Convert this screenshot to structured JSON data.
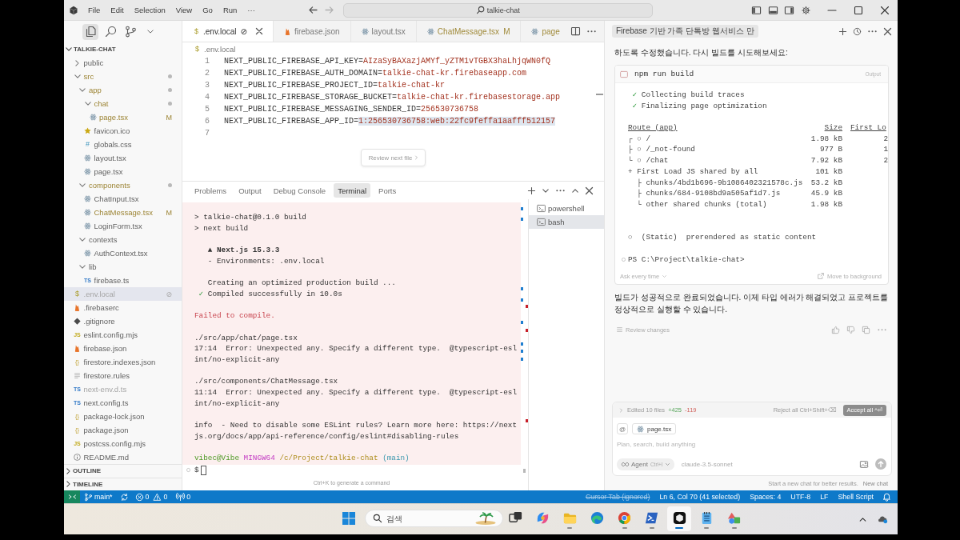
{
  "window": {
    "menu": [
      "File",
      "Edit",
      "Selection",
      "View",
      "Go",
      "Run",
      "···"
    ],
    "command_center": "talkie-chat"
  },
  "activity": [
    {
      "kind": "files",
      "selected": true
    },
    {
      "kind": "search",
      "selected": false
    },
    {
      "kind": "source-control",
      "selected": false
    },
    {
      "kind": "more",
      "selected": false
    }
  ],
  "explorer": {
    "title": "TALKIE-CHAT",
    "expanded": true,
    "tree": [
      {
        "name": "public",
        "kind": "folder",
        "expanded": false,
        "selected": false,
        "modified": false,
        "ignored": false
      },
      {
        "name": "src",
        "kind": "folder",
        "expanded": true,
        "selected": false,
        "modified": true,
        "ignored": false,
        "children": [
          {
            "name": "app",
            "kind": "folder",
            "expanded": true,
            "selected": false,
            "modified": true,
            "ignored": false,
            "children": [
              {
                "name": "chat",
                "kind": "folder",
                "expanded": true,
                "selected": false,
                "modified": true,
                "ignored": false,
                "children": [
                  {
                    "name": "page.tsx",
                    "kind": "react",
                    "badge": "M",
                    "selected": false,
                    "modified": true,
                    "ignored": false
                  }
                ]
              },
              {
                "name": "favicon.ico",
                "kind": "star",
                "selected": false,
                "modified": false,
                "ignored": false
              },
              {
                "name": "globals.css",
                "kind": "css",
                "glyph": "#",
                "selected": false,
                "modified": false,
                "ignored": false
              },
              {
                "name": "layout.tsx",
                "kind": "react",
                "selected": false,
                "modified": false,
                "ignored": false
              },
              {
                "name": "page.tsx",
                "kind": "react",
                "selected": false,
                "modified": false,
                "ignored": false
              }
            ]
          },
          {
            "name": "components",
            "kind": "folder",
            "expanded": true,
            "selected": false,
            "modified": true,
            "ignored": false,
            "children": [
              {
                "name": "ChatInput.tsx",
                "kind": "react",
                "selected": false,
                "modified": false,
                "ignored": false
              },
              {
                "name": "ChatMessage.tsx",
                "kind": "react",
                "badge": "M",
                "selected": false,
                "modified": true,
                "ignored": false
              },
              {
                "name": "LoginForm.tsx",
                "kind": "react",
                "selected": false,
                "modified": false,
                "ignored": false
              }
            ]
          },
          {
            "name": "contexts",
            "kind": "folder",
            "expanded": true,
            "selected": false,
            "modified": false,
            "ignored": false,
            "children": [
              {
                "name": "AuthContext.tsx",
                "kind": "react",
                "selected": false,
                "modified": false,
                "ignored": false
              }
            ]
          },
          {
            "name": "lib",
            "kind": "folder",
            "expanded": true,
            "selected": false,
            "modified": false,
            "ignored": false,
            "children": [
              {
                "name": "firebase.ts",
                "kind": "ts",
                "glyph": "TS",
                "selected": false,
                "modified": false,
                "ignored": false
              }
            ]
          }
        ]
      },
      {
        "name": ".env.local",
        "kind": "env",
        "glyph": "$",
        "badge": "⊘",
        "selected": true,
        "modified": false,
        "ignored": true
      },
      {
        "name": ".firebaserc",
        "kind": "firebase",
        "selected": false,
        "modified": false,
        "ignored": false
      },
      {
        "name": ".gitignore",
        "kind": "git",
        "selected": false,
        "modified": false,
        "ignored": false
      },
      {
        "name": "eslint.config.mjs",
        "kind": "js",
        "glyph": "JS",
        "selected": false,
        "modified": false,
        "ignored": false
      },
      {
        "name": "firebase.json",
        "kind": "firebase",
        "selected": false,
        "modified": false,
        "ignored": false
      },
      {
        "name": "firestore.indexes.json",
        "kind": "json",
        "glyph": "{}",
        "selected": false,
        "modified": false,
        "ignored": false
      },
      {
        "name": "firestore.rules",
        "kind": "lines",
        "selected": false,
        "modified": false,
        "ignored": false
      },
      {
        "name": "next-env.d.ts",
        "kind": "ts",
        "glyph": "TS",
        "selected": false,
        "modified": false,
        "ignored": true
      },
      {
        "name": "next.config.ts",
        "kind": "ts",
        "glyph": "TS",
        "selected": false,
        "modified": false,
        "ignored": false
      },
      {
        "name": "package-lock.json",
        "kind": "json",
        "glyph": "{}",
        "selected": false,
        "modified": false,
        "ignored": false
      },
      {
        "name": "package.json",
        "kind": "json",
        "glyph": "{}",
        "selected": false,
        "modified": false,
        "ignored": false
      },
      {
        "name": "postcss.config.mjs",
        "kind": "js",
        "glyph": "JS",
        "selected": false,
        "modified": false,
        "ignored": false
      },
      {
        "name": "README.md",
        "kind": "info",
        "selected": false,
        "modified": false,
        "ignored": false
      }
    ]
  },
  "sections": [
    {
      "title": "OUTLINE",
      "expanded": false
    },
    {
      "title": "TIMELINE",
      "expanded": false
    }
  ],
  "editor": {
    "tabs": [
      {
        "label": ".env.local",
        "kind": "env",
        "glyph": "$",
        "badge": "⊘",
        "selected": true,
        "modified": false
      },
      {
        "label": "firebase.json",
        "kind": "firebase",
        "selected": false,
        "modified": false
      },
      {
        "label": "layout.tsx",
        "kind": "react",
        "selected": false,
        "modified": false
      },
      {
        "label": "ChatMessage.tsx",
        "kind": "react",
        "badge": "M",
        "selected": false,
        "modified": true
      },
      {
        "label": "page",
        "kind": "react",
        "selected": false,
        "modified": true
      }
    ],
    "breadcrumb": {
      "kind": "env",
      "glyph": "$",
      "label": ".env.local"
    },
    "lines": [
      {
        "number": "1",
        "key": "NEXT_PUBLIC_FIREBASE_API_KEY=",
        "value": "AIzaSyBAXazjAMYf_yZTM1vTGBX3haLhjqWN0fQ",
        "highlighted": false
      },
      {
        "number": "2",
        "key": "NEXT_PUBLIC_FIREBASE_AUTH_DOMAIN=",
        "value": "talkie-chat-kr.firebaseapp.com",
        "highlighted": false
      },
      {
        "number": "3",
        "key": "NEXT_PUBLIC_FIREBASE_PROJECT_ID=",
        "value": "talkie-chat-kr",
        "highlighted": false
      },
      {
        "number": "4",
        "key": "NEXT_PUBLIC_FIREBASE_STORAGE_BUCKET=",
        "value": "talkie-chat-kr.firebasestorage.app",
        "highlighted": false
      },
      {
        "number": "5",
        "key": "NEXT_PUBLIC_FIREBASE_MESSAGING_SENDER_ID=",
        "value": "256530736758",
        "highlighted": false
      },
      {
        "number": "6",
        "key": "NEXT_PUBLIC_FIREBASE_APP_ID=",
        "value": "1:256530736758:web:22fc9feffa1aafff512157",
        "highlighted": true
      },
      {
        "number": "7"
      }
    ],
    "review_button": "Review next file"
  },
  "panel": {
    "tabs": [
      {
        "label": "Problems",
        "selected": false
      },
      {
        "label": "Output",
        "selected": false
      },
      {
        "label": "Debug Console",
        "selected": false
      },
      {
        "label": "Terminal",
        "selected": true
      },
      {
        "label": "Ports",
        "selected": false
      }
    ],
    "terminal": {
      "lines": [
        {
          "kind": "text",
          "segments": [
            {
              "text": "> talkie-chat@0.1.0 build",
              "kind": "plain"
            }
          ]
        },
        {
          "kind": "text",
          "segments": [
            {
              "text": "> next build",
              "kind": "plain"
            }
          ]
        },
        {
          "kind": "blank"
        },
        {
          "kind": "text",
          "segments": [
            {
              "text": "   ▲ Next.js 15.3.3",
              "kind": "bold"
            }
          ]
        },
        {
          "kind": "text",
          "segments": [
            {
              "text": "   - Environments: .env.local",
              "kind": "plain"
            }
          ]
        },
        {
          "kind": "blank"
        },
        {
          "kind": "text",
          "segments": [
            {
              "text": "   Creating an optimized production build ...",
              "kind": "plain"
            }
          ]
        },
        {
          "kind": "text",
          "segments": [
            {
              "text": " ✓",
              "kind": "ok"
            },
            {
              "text": " Compiled successfully in 10.0s",
              "kind": "plain"
            }
          ]
        },
        {
          "kind": "blank"
        },
        {
          "kind": "text",
          "segments": [
            {
              "text": "Failed to compile.",
              "kind": "error"
            }
          ]
        },
        {
          "kind": "blank"
        },
        {
          "kind": "text",
          "segments": [
            {
              "text": "./src/app/chat/page.tsx",
              "kind": "plain"
            }
          ]
        },
        {
          "kind": "text",
          "segments": [
            {
              "text": "17:14  Error: Unexpected any. Specify a different type.  @typescript-esl",
              "kind": "plain"
            }
          ]
        },
        {
          "kind": "text",
          "segments": [
            {
              "text": "int/no-explicit-any",
              "kind": "plain"
            }
          ]
        },
        {
          "kind": "blank"
        },
        {
          "kind": "text",
          "segments": [
            {
              "text": "./src/components/ChatMessage.tsx",
              "kind": "plain"
            }
          ]
        },
        {
          "kind": "text",
          "segments": [
            {
              "text": "11:14  Error: Unexpected any. Specify a different type.  @typescript-esl",
              "kind": "plain"
            }
          ]
        },
        {
          "kind": "text",
          "segments": [
            {
              "text": "int/no-explicit-any",
              "kind": "plain"
            }
          ]
        },
        {
          "kind": "blank"
        },
        {
          "kind": "text",
          "segments": [
            {
              "text": "info  - Need to disable some ESLint rules? Learn more here: https://next",
              "kind": "plain"
            }
          ]
        },
        {
          "kind": "text",
          "segments": [
            {
              "text": "js.org/docs/app/api-reference/config/eslint#disabling-rules",
              "kind": "plain"
            }
          ]
        },
        {
          "kind": "blank"
        },
        {
          "kind": "text",
          "segments": [
            {
              "text": "vibec@Vibe",
              "kind": "user"
            },
            {
              "text": " MINGW64",
              "kind": "host"
            },
            {
              "text": " /c/Project/talkie-chat",
              "kind": "path"
            },
            {
              "text": " (main)",
              "kind": "branch"
            }
          ]
        }
      ],
      "prompt": "$",
      "hint": "Ctrl+K to generate a command"
    },
    "terminals": [
      {
        "name": "powershell",
        "selected": false
      },
      {
        "name": "bash",
        "selected": true
      }
    ]
  },
  "chat": {
    "title": "Firebase 기반 가족 단톡방 웹서비스 만",
    "intro": "하도록 수정했습니다. 다시 빌드를 시도해보세요:",
    "command_card": {
      "command": "npm run build",
      "output_label": "Output",
      "lines": [
        {
          "kind": "text",
          "segments": [
            {
              "text": " ✓",
              "kind": "ok"
            },
            {
              "text": " Collecting build traces",
              "kind": "plain"
            }
          ]
        },
        {
          "kind": "text",
          "segments": [
            {
              "text": " ✓",
              "kind": "ok"
            },
            {
              "text": " Finalizing page optimization",
              "kind": "plain"
            }
          ]
        }
      ],
      "routes": {
        "columns": [
          "Route (app)",
          "Size",
          "First Lo"
        ],
        "rows": [
          {
            "name": "┌ ○ /",
            "size": "1.98 kB",
            "first_load": "2"
          },
          {
            "name": "├ ○ /_not-found",
            "size": "977 B",
            "first_load": "1"
          },
          {
            "name": "└ ○ /chat",
            "size": "7.92 kB",
            "first_load": "2"
          },
          {
            "name": "+ First Load JS shared by all",
            "size": "101 kB"
          },
          {
            "name": "  ├ chunks/4bd1b696-9b1086402321578c.js",
            "size": "53.2 kB"
          },
          {
            "name": "  ├ chunks/684-9108bd9a505af1d7.js",
            "size": "45.9 kB"
          },
          {
            "name": "  └ other shared chunks (total)",
            "size": "1.98 kB"
          }
        ]
      },
      "legend": "○  (Static)  prerendered as static content",
      "prompt": "PS C:\\Project\\talkie-chat>",
      "approval": "Ask every time",
      "background_button": "Move to background"
    },
    "reply": "빌드가 성공적으로 완료되었습니다. 이제 타입 에러가 해결되었고 프로젝트를 정상적으로 실행할 수 있습니다.",
    "review": "Review changes",
    "composer": {
      "edited": "Edited 10 files",
      "added": "+425",
      "removed": "-119",
      "reject": "Reject all Ctrl+Shift+⌫",
      "accept": "Accept all ^⏎",
      "mention": "@",
      "context_file": {
        "kind": "react",
        "label": "page.tsx"
      },
      "placeholder": "Plan, search, build anything",
      "mode": "Agent",
      "mode_shortcut": "Ctrl+I",
      "model": "claude-3.5-sonnet",
      "footer": "Start a new chat for better results.",
      "new_chat": "New chat"
    }
  },
  "status_bar": {
    "branch": "main*",
    "errors": "0",
    "warnings": "0",
    "ports": "0",
    "items": [
      {
        "text": "Cursor Tab (ignored)",
        "disabled": true
      },
      {
        "text": "Ln 6, Col 70 (41 selected)",
        "disabled": false
      },
      {
        "text": "Spaces: 4",
        "disabled": false
      },
      {
        "text": "UTF-8",
        "disabled": false
      },
      {
        "text": "LF",
        "disabled": false
      },
      {
        "text": "Shell Script",
        "disabled": false
      }
    ]
  },
  "taskbar": {
    "search": {
      "placeholder": "검색"
    },
    "apps": [
      {
        "kind": "task-view",
        "selected": false,
        "running": false
      },
      {
        "kind": "copilot",
        "selected": false,
        "running": false
      },
      {
        "kind": "folder",
        "selected": false,
        "running": true
      },
      {
        "kind": "edge",
        "selected": false,
        "running": false
      },
      {
        "kind": "chrome",
        "selected": false,
        "running": true
      },
      {
        "kind": "terminal",
        "selected": false,
        "running": true
      },
      {
        "kind": "cursor",
        "selected": true,
        "running": true
      },
      {
        "kind": "notepad",
        "selected": false,
        "running": true
      },
      {
        "kind": "paint",
        "selected": false,
        "running": true
      }
    ]
  }
}
